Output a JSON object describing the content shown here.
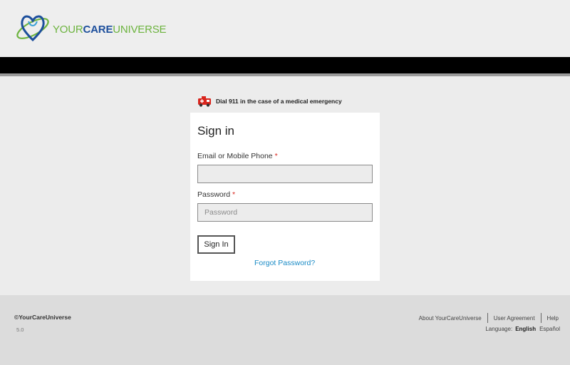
{
  "header": {
    "brand_part1": "YOUR",
    "brand_part2": "CARE",
    "brand_part3": "UNIVERSE"
  },
  "emergency_notice": "Dial 911 in the case of a medical emergency",
  "signin": {
    "title": "Sign in",
    "email_label": "Email or Mobile Phone",
    "email_value": "",
    "password_label": "Password",
    "password_placeholder": "Password",
    "required_mark": "*",
    "submit_label": "Sign In",
    "forgot_label": "Forgot Password?"
  },
  "footer": {
    "copyright": "©YourCareUniverse",
    "version": "5.0",
    "links": [
      "About YourCareUniverse",
      "User Agreement",
      "Help"
    ],
    "language_label": "Language:",
    "languages": [
      "English",
      "Español"
    ],
    "selected_language": "English"
  },
  "colors": {
    "brand_green": "#6cb33e",
    "brand_blue": "#1d4f9c",
    "link_blue": "#1a8bc6",
    "required_red": "#d9251d",
    "emergency_icon_red": "#d9251d"
  }
}
